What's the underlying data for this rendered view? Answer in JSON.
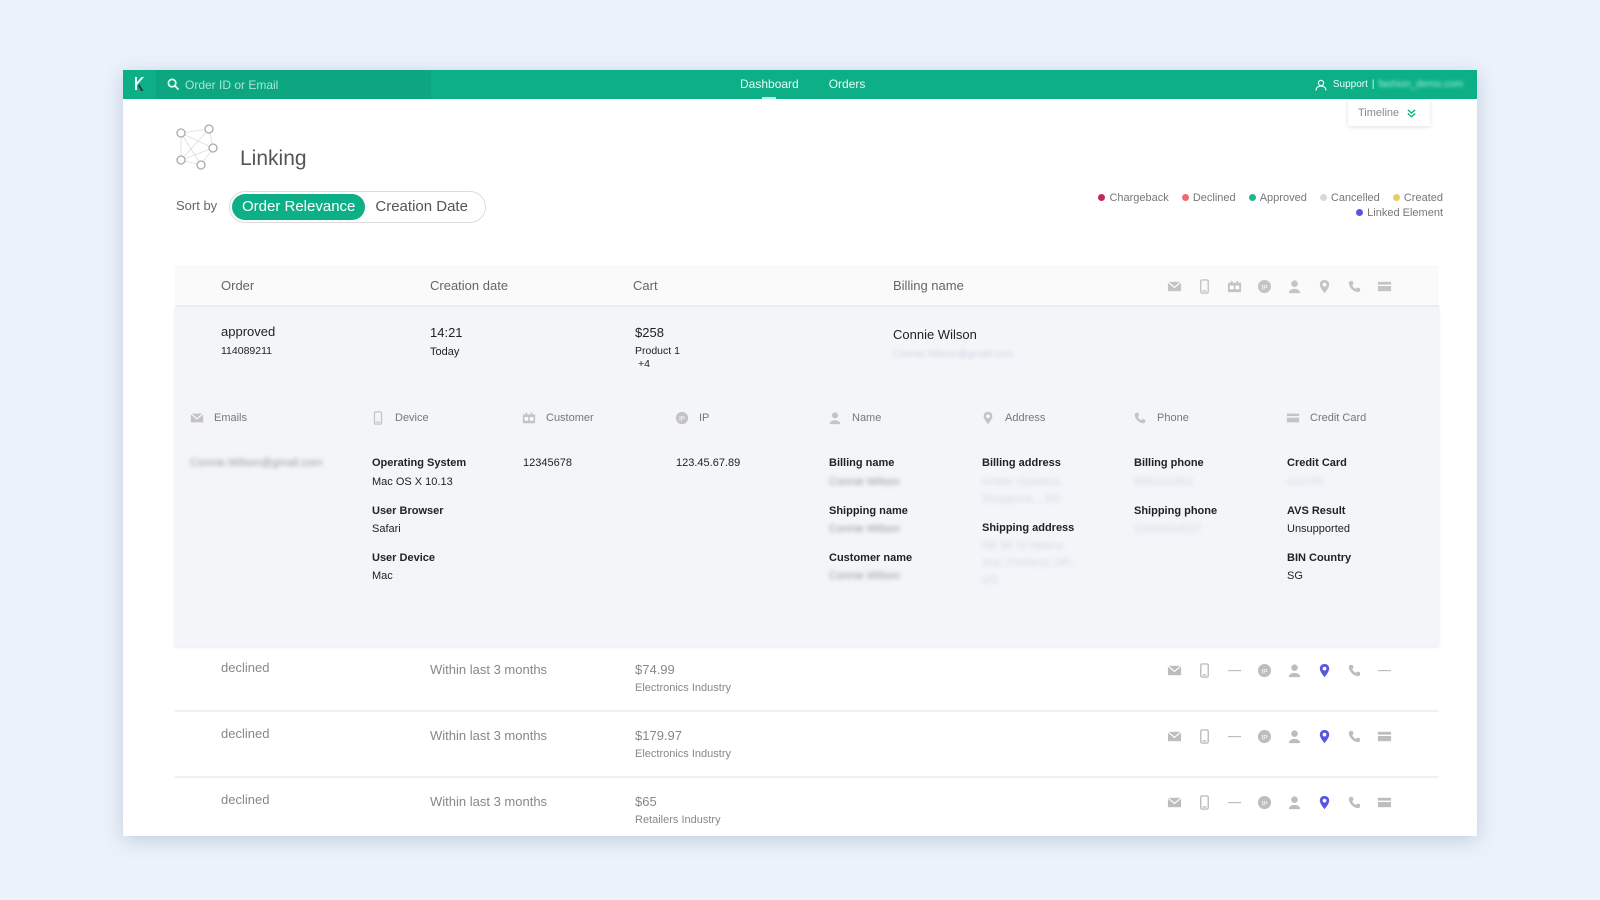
{
  "topbar": {
    "search_placeholder": "Order ID or Email",
    "nav": [
      {
        "label": "Dashboard",
        "active": true
      },
      {
        "label": "Orders",
        "active": false
      }
    ],
    "support_label": "Support",
    "separator": "|",
    "username": "fashion_demo.com"
  },
  "timeline": {
    "label": "Timeline"
  },
  "header": {
    "title": "Linking",
    "sort_label": "Sort by",
    "sort_options": [
      {
        "label": "Order Relevance",
        "active": true
      },
      {
        "label": "Creation Date",
        "active": false
      }
    ]
  },
  "legend": [
    {
      "label": "Chargeback",
      "color": "#c0285a"
    },
    {
      "label": "Declined",
      "color": "#f06a6a"
    },
    {
      "label": "Approved",
      "color": "#1db58f"
    },
    {
      "label": "Cancelled",
      "color": "#d8d8d8"
    },
    {
      "label": "Created",
      "color": "#e8cc6a"
    },
    {
      "label": "Linked Element",
      "color": "#5a55e0"
    }
  ],
  "table": {
    "headers": {
      "order": "Order",
      "creation_date": "Creation date",
      "cart": "Cart",
      "billing_name": "Billing name"
    },
    "header_icons": [
      "email-icon",
      "device-icon",
      "customer-icon",
      "ip-icon",
      "name-icon",
      "address-icon",
      "phone-icon",
      "credit-card-icon"
    ],
    "expanded_order": {
      "status": "approved",
      "order_id": "114089211",
      "time": "14:21",
      "day": "Today",
      "amount": "$258",
      "product": "Product 1",
      "more_products": "+4",
      "billing_name": "Connie Wilson",
      "billing_email": "Connie.Wilson@gmail.com",
      "link_headers": {
        "emails": "Emails",
        "device": "Device",
        "customer": "Customer",
        "ip": "IP",
        "name": "Name",
        "address": "Address",
        "phone": "Phone",
        "credit_card": "Credit Card"
      },
      "emails_value": "Connie.Wilson@gmail.com",
      "device": {
        "os_label": "Operating System",
        "os_value": "Mac OS X 10.13",
        "browser_label": "User Browser",
        "browser_value": "Safari",
        "device_label": "User Device",
        "device_value": "Mac"
      },
      "customer_value": "12345678",
      "ip_value": "123.45.67.89",
      "name": {
        "billing_label": "Billing name",
        "billing_value": "Connie Wilson",
        "shipping_label": "Shipping name",
        "shipping_value": "Connie Wilson",
        "customer_label": "Customer name",
        "customer_value": "Connie Wilson"
      },
      "address": {
        "billing_label": "Billing address",
        "billing_line1": "Amber Gardens,",
        "billing_line2": "Singapore, , SG",
        "shipping_label": "Shipping address",
        "shipping_line1": "NE 86 St Helens",
        "shipping_line2": "Ave, Portland, OR,",
        "shipping_line3": "US"
      },
      "phone": {
        "billing_label": "Billing phone",
        "billing_value": "6591111852",
        "shipping_label": "Shipping phone",
        "shipping_value": "15035414237"
      },
      "card": {
        "card_label": "Credit Card",
        "card_value": "414745",
        "avs_label": "AVS Result",
        "avs_value": "Unsupported",
        "bin_label": "BIN Country",
        "bin_value": "SG"
      }
    },
    "rows": [
      {
        "status": "declined",
        "date": "Within last 3 months",
        "amount": "$74.99",
        "industry": "Electronics Industry",
        "linked_icon": "address-icon",
        "has_customer": false,
        "has_card": false
      },
      {
        "status": "declined",
        "date": "Within last 3 months",
        "amount": "$179.97",
        "industry": "Electronics Industry",
        "linked_icon": "address-icon",
        "has_customer": false,
        "has_card": true
      },
      {
        "status": "declined",
        "date": "Within last 3 months",
        "amount": "$65",
        "industry": "Retailers Industry",
        "linked_icon": "address-icon",
        "has_customer": false,
        "has_card": true
      }
    ]
  },
  "colors": {
    "brand": "#0daf87",
    "linked": "#5a55e0",
    "icon_gray": "#b5b5b5"
  }
}
